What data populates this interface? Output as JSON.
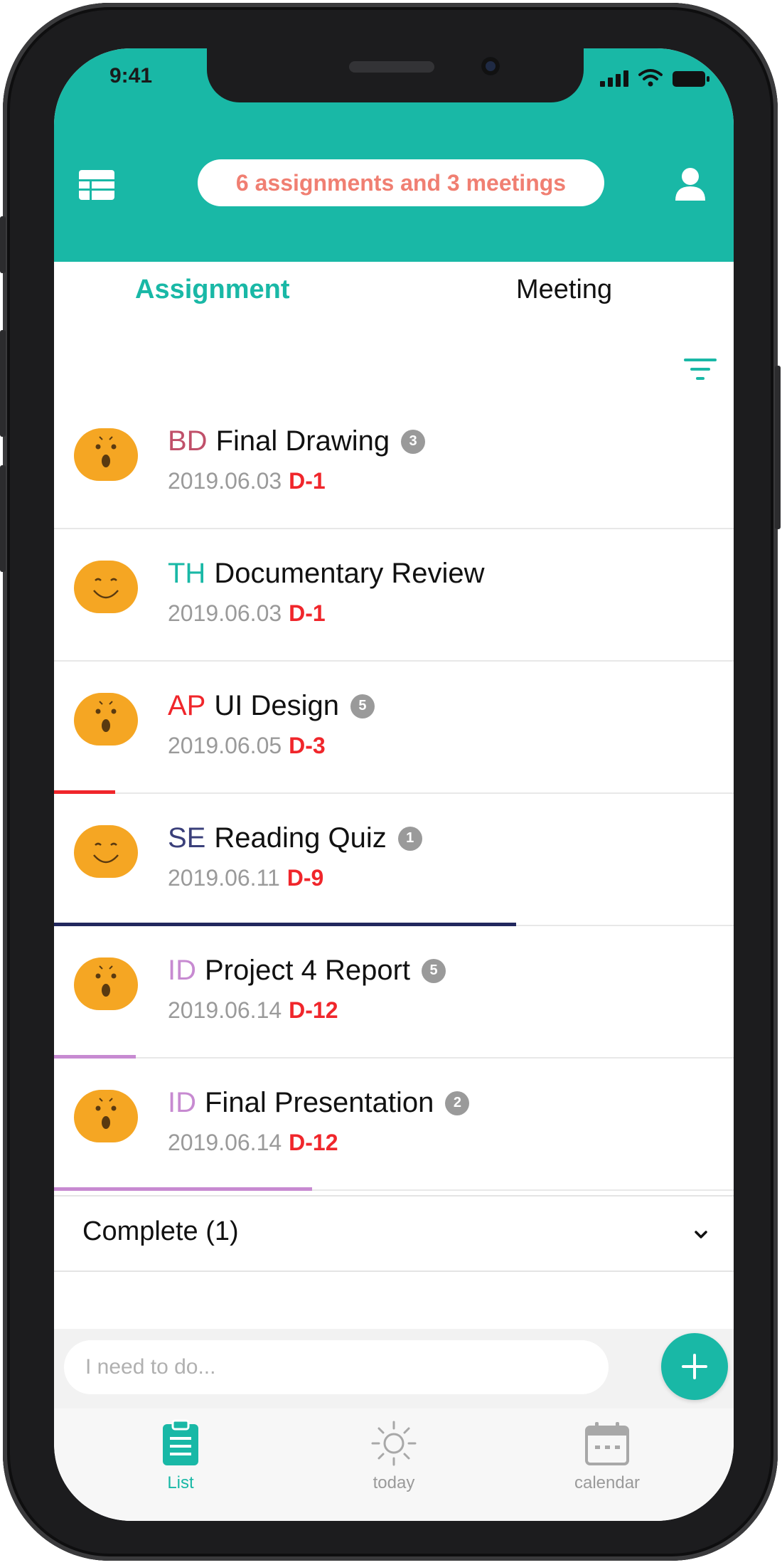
{
  "status_bar": {
    "time": "9:41"
  },
  "header": {
    "summary": "6 assignments and 3 meetings"
  },
  "tabs": [
    {
      "label": "Assignment",
      "active": true
    },
    {
      "label": "Meeting",
      "active": false
    }
  ],
  "assignments": [
    {
      "code": "BD",
      "code_color": "#c0506a",
      "title": "Final Drawing",
      "badge": "3",
      "date": "2019.06.03",
      "dday": "D-1",
      "face": "surprised",
      "progress_color": "",
      "progress": 0
    },
    {
      "code": "TH",
      "code_color": "#19b8a6",
      "title": "Documentary Review",
      "badge": "",
      "date": "2019.06.03",
      "dday": "D-1",
      "face": "smile",
      "progress_color": "",
      "progress": 0
    },
    {
      "code": "AP",
      "code_color": "#f0262b",
      "title": "UI Design",
      "badge": "5",
      "date": "2019.06.05",
      "dday": "D-3",
      "face": "surprised",
      "progress_color": "#f0262b",
      "progress": 0.09
    },
    {
      "code": "SE",
      "code_color": "#3a3f7a",
      "title": "Reading Quiz",
      "badge": "1",
      "date": "2019.06.11",
      "dday": "D-9",
      "face": "smile",
      "progress_color": "#22285e",
      "progress": 0.68
    },
    {
      "code": "ID",
      "code_color": "#c78ad1",
      "title": "Project 4 Report",
      "badge": "5",
      "date": "2019.06.14",
      "dday": "D-12",
      "face": "surprised",
      "progress_color": "#c78ad1",
      "progress": 0.12
    },
    {
      "code": "ID",
      "code_color": "#c78ad1",
      "title": "Final Presentation",
      "badge": "2",
      "date": "2019.06.14",
      "dday": "D-12",
      "face": "surprised",
      "progress_color": "#c78ad1",
      "progress": 0.38
    }
  ],
  "complete": {
    "label": "Complete (1)"
  },
  "input": {
    "placeholder": "I need to do..."
  },
  "bottom_nav": [
    {
      "label": "List",
      "icon": "clipboard-icon",
      "active": true
    },
    {
      "label": "today",
      "icon": "sun-icon",
      "active": false
    },
    {
      "label": "calendar",
      "icon": "calendar-icon",
      "active": false
    }
  ],
  "colors": {
    "accent": "#19b8a6",
    "dday": "#f0262b",
    "face": "#f5a623",
    "summary_text": "#f07f72"
  }
}
